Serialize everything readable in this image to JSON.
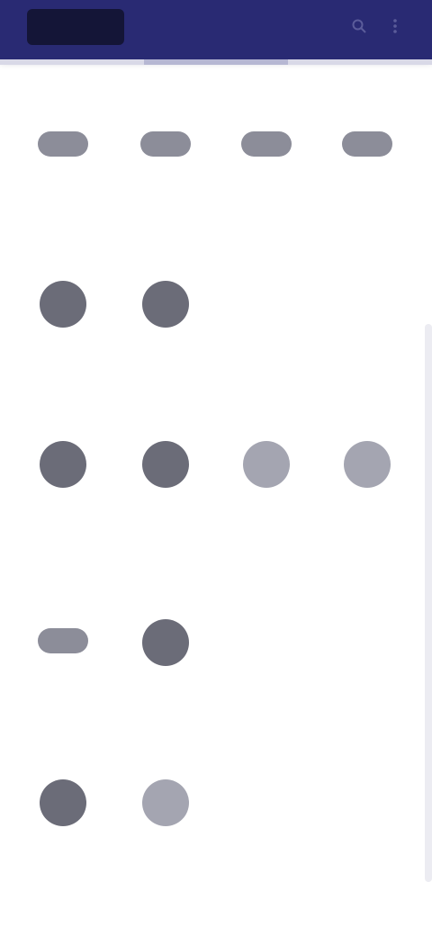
{
  "app": {
    "title": ""
  },
  "header": {
    "actions": [
      {
        "icon": "search-icon"
      },
      {
        "icon": "more-vert-icon"
      }
    ]
  },
  "colors": {
    "appbar": "#292a73",
    "logo": "#141537",
    "tile_dark": "#6b6c78",
    "tile_light": "#a4a5b1",
    "label": "#8c8c99"
  },
  "main": {
    "top_title": "",
    "sections": [
      {
        "title": "",
        "items": [
          {
            "label": "",
            "icon": "app-icon"
          },
          {
            "label": "",
            "icon": "app-icon"
          },
          {
            "label": "",
            "icon": "app-icon"
          },
          {
            "label": "",
            "icon": "app-icon"
          }
        ]
      },
      {
        "title": "",
        "items": [
          {
            "label": "",
            "icon": "app-icon"
          },
          {
            "label": "",
            "icon": "app-icon"
          }
        ]
      },
      {
        "title": "",
        "items": [
          {
            "label": "",
            "icon": "app-icon"
          },
          {
            "label": "",
            "icon": "app-icon"
          },
          {
            "label": "",
            "icon": "app-icon"
          },
          {
            "label": "",
            "icon": "app-icon"
          }
        ]
      },
      {
        "title": "",
        "items": [
          {
            "label": "",
            "icon": "app-icon"
          },
          {
            "label": "",
            "icon": "app-icon"
          }
        ]
      },
      {
        "title": "",
        "items": [
          {
            "label": "",
            "icon": "app-icon"
          },
          {
            "label": "",
            "icon": "app-icon"
          }
        ]
      }
    ]
  }
}
